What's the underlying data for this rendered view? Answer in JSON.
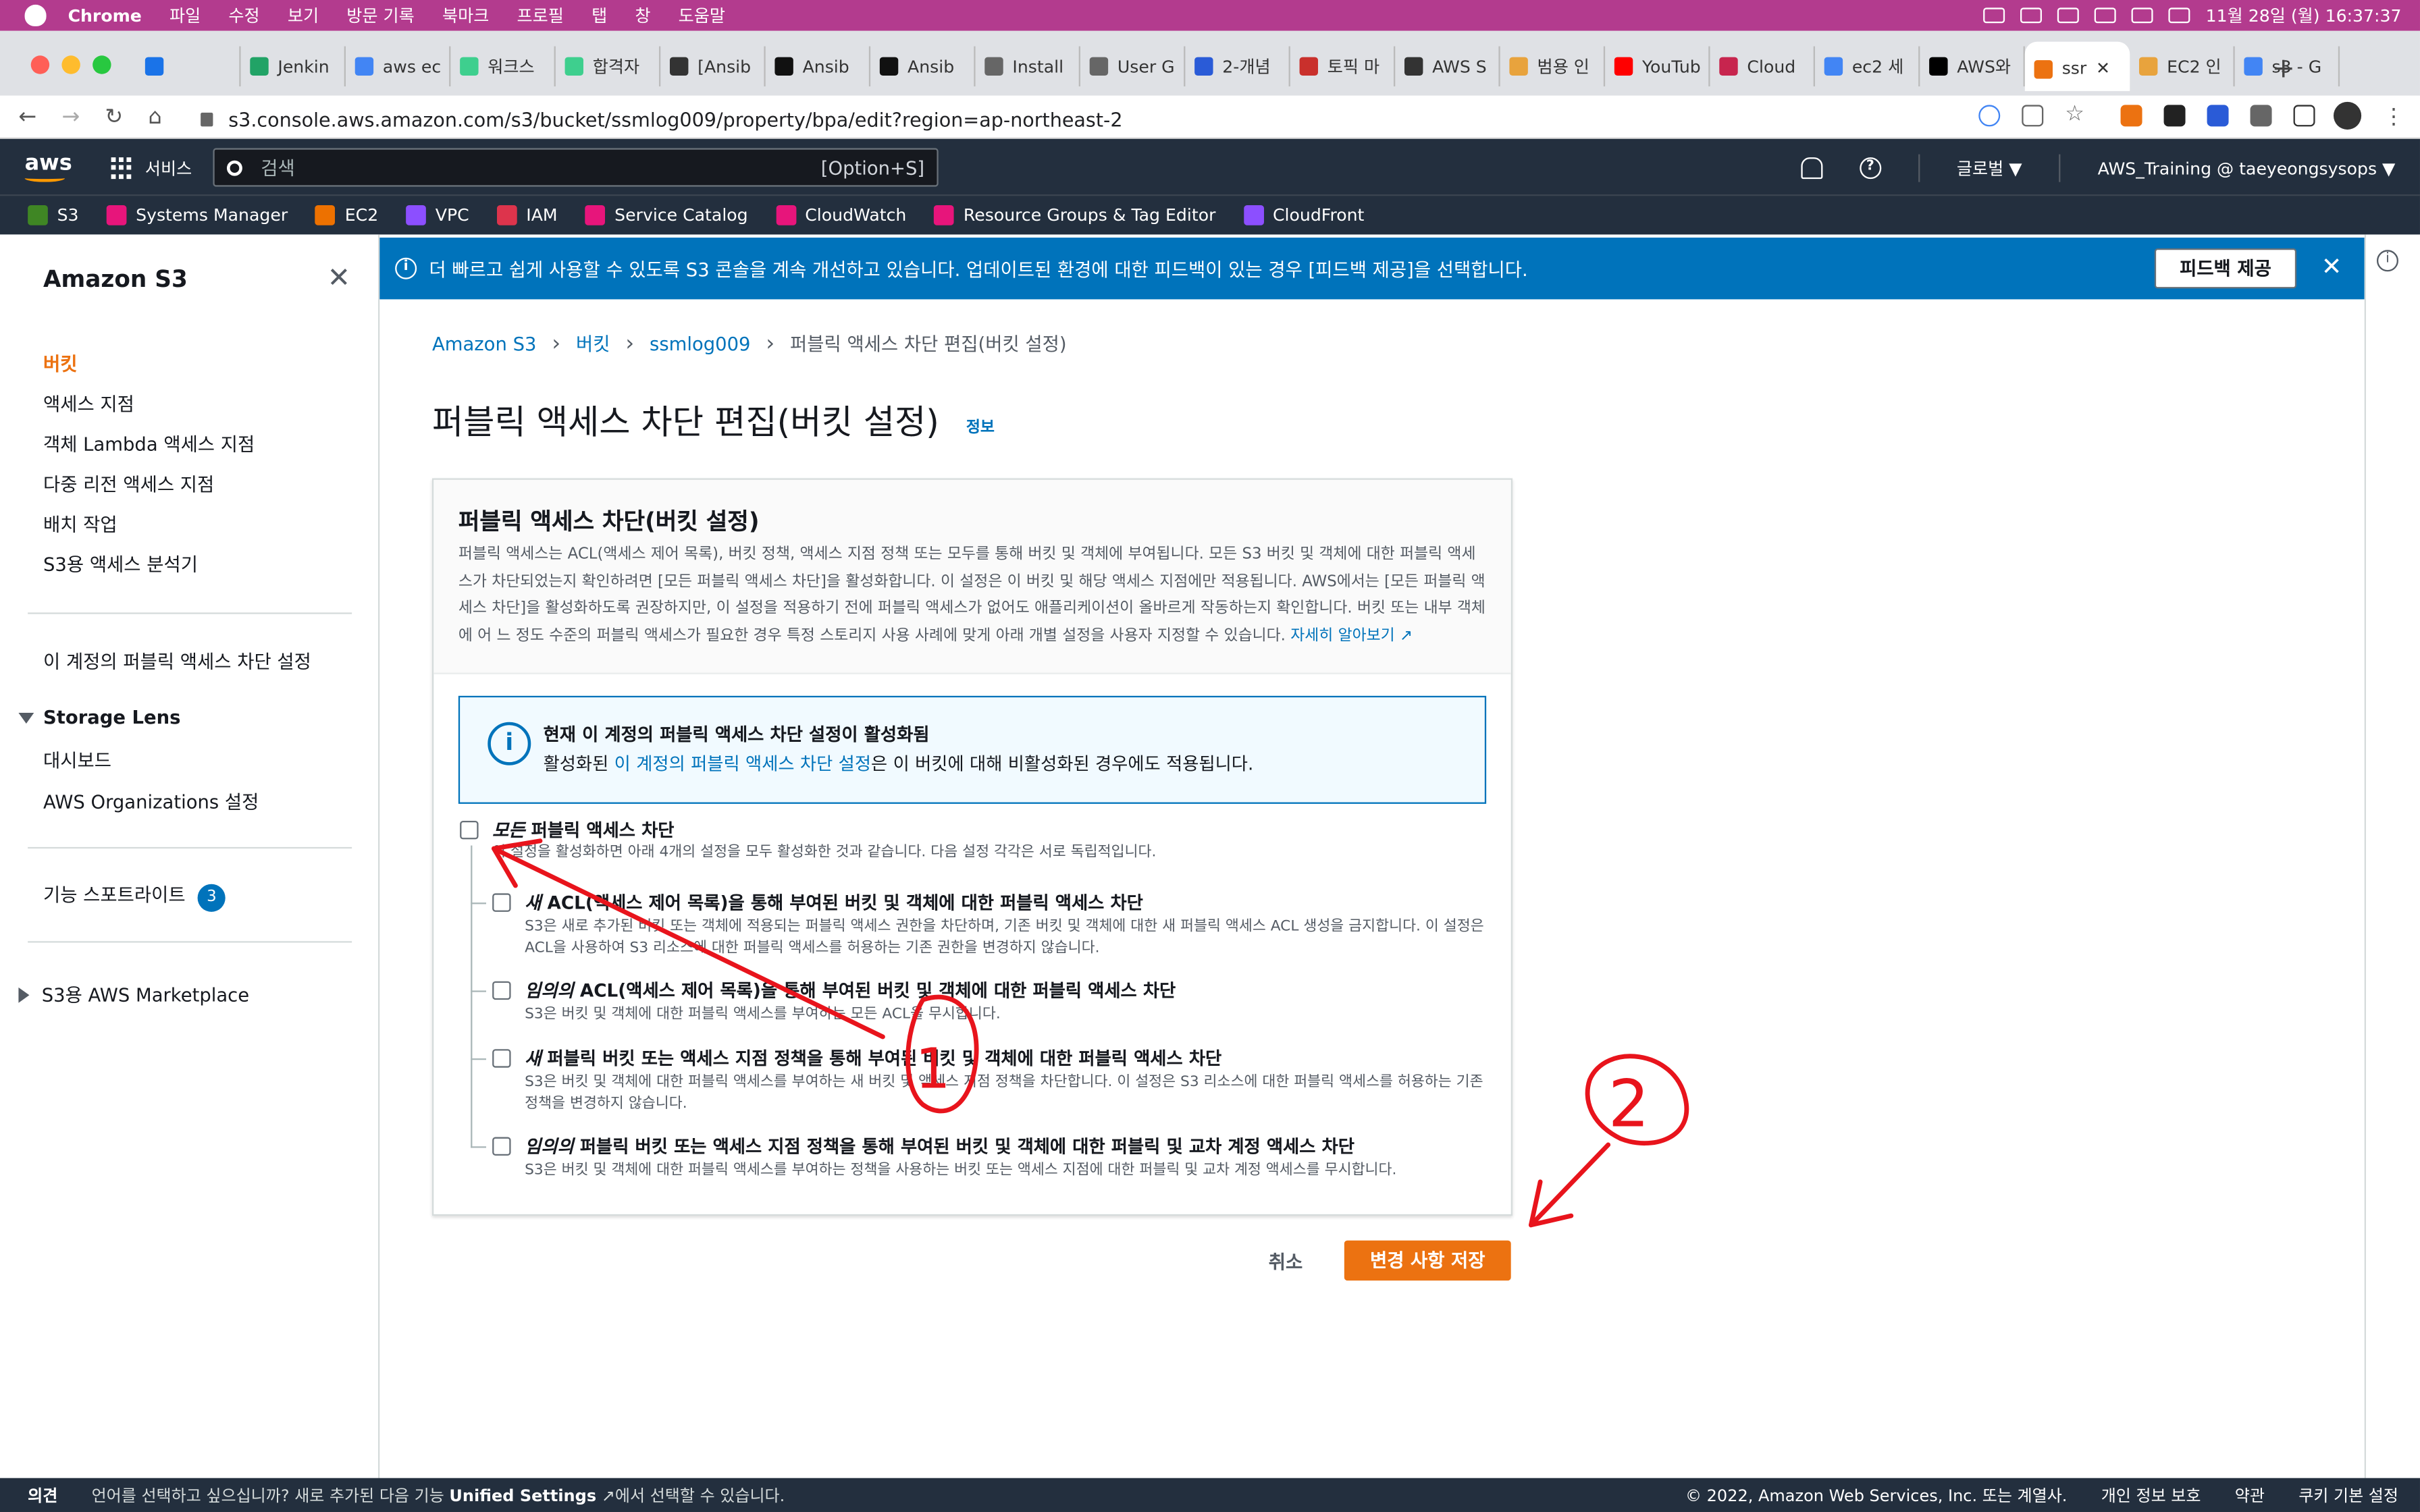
{
  "mac_menu": {
    "app": "Chrome",
    "items": [
      "파일",
      "수정",
      "보기",
      "방문 기록",
      "북마크",
      "프로필",
      "탭",
      "창",
      "도움말"
    ],
    "datetime": "11월 28일 (월)  16:37:37"
  },
  "browser": {
    "tabs": [
      {
        "label": "",
        "color": "#1a73e8"
      },
      {
        "label": "Jenkin",
        "color": "#21a366"
      },
      {
        "label": "aws ec",
        "color": "#4285f4"
      },
      {
        "label": "워크스",
        "color": "#3ecf8e"
      },
      {
        "label": "합격자",
        "color": "#3ecf8e"
      },
      {
        "label": "[Ansib",
        "color": "#333333"
      },
      {
        "label": "Ansib",
        "color": "#111111"
      },
      {
        "label": "Ansib",
        "color": "#111111"
      },
      {
        "label": "Install",
        "color": "#666666"
      },
      {
        "label": "User G",
        "color": "#666666"
      },
      {
        "label": "2-개념",
        "color": "#2a5bd7"
      },
      {
        "label": "토픽 마",
        "color": "#c9302c"
      },
      {
        "label": "AWS S",
        "color": "#333333"
      },
      {
        "label": "범용 인",
        "color": "#e8a33d"
      },
      {
        "label": "YouTub",
        "color": "#ff0000"
      },
      {
        "label": "Cloud",
        "color": "#c7254e"
      },
      {
        "label": "ec2 세",
        "color": "#4285f4"
      },
      {
        "label": "AWS와",
        "color": "#000000"
      },
      {
        "label": "ssr",
        "color": "#ec7211",
        "active": true
      },
      {
        "label": "EC2 인",
        "color": "#e8a33d"
      },
      {
        "label": "s3 - G",
        "color": "#4285f4"
      }
    ],
    "url": "s3.console.aws.amazon.com/s3/bucket/ssmlog009/property/bpa/edit?region=ap-northeast-2"
  },
  "aws_header": {
    "logo": "aws",
    "services": "서비스",
    "search_placeholder": "검색",
    "search_shortcut": "[Option+S]",
    "region": "글로벌 ▼",
    "account": "AWS_Training @ taeyeongsysops ▼"
  },
  "favorites": [
    {
      "label": "S3",
      "color": "#3f8624"
    },
    {
      "label": "Systems Manager",
      "color": "#e7157b"
    },
    {
      "label": "EC2",
      "color": "#ed7100"
    },
    {
      "label": "VPC",
      "color": "#8c4fff"
    },
    {
      "label": "IAM",
      "color": "#dd344c"
    },
    {
      "label": "Service Catalog",
      "color": "#e7157b"
    },
    {
      "label": "CloudWatch",
      "color": "#e7157b"
    },
    {
      "label": "Resource Groups & Tag Editor",
      "color": "#e7157b"
    },
    {
      "label": "CloudFront",
      "color": "#8c4fff"
    }
  ],
  "sidebar": {
    "title": "Amazon S3",
    "items": [
      "버킷",
      "액세스 지점",
      "객체 Lambda 액세스 지점",
      "다중 리전 액세스 지점",
      "배치 작업",
      "S3용 액세스 분석기"
    ],
    "account_bpa": "이 계정의 퍼블릭 액세스 차단 설정",
    "storage_lens": "Storage Lens",
    "storage_lens_items": [
      "대시보드",
      "AWS Organizations 설정"
    ],
    "feature_spotlight": "기능 스포트라이트",
    "feature_spotlight_count": "3",
    "marketplace": "S3용 AWS Marketplace"
  },
  "flash": {
    "message": "더 빠르고 쉽게 사용할 수 있도록 S3 콘솔을 계속 개선하고 있습니다. 업데이트된 환경에 대한 피드백이 있는 경우 [피드백 제공]을 선택합니다.",
    "button": "피드백 제공"
  },
  "breadcrumb": {
    "items": [
      "Amazon S3",
      "버킷",
      "ssmlog009"
    ],
    "current": "퍼블릭 액세스 차단 편집(버킷 설정)"
  },
  "page": {
    "title": "퍼블릭 액세스 차단 편집(버킷 설정)",
    "info": "정보"
  },
  "panel": {
    "title": "퍼블릭 액세스 차단(버킷 설정)",
    "desc_lines": [
      "퍼블릭 액세스는 ACL(액세스 제어 목록), 버킷 정책, 액세스 지점 정책 또는 모두를 통해 버킷 및 객체에 부여됩니다. 모든 S3 버킷 및 객체에 대한 퍼블릭 액세스가",
      "차단되었는지 확인하려면 [모든 퍼블릭 액세스 차단]을 활성화합니다. 이 설정은 이 버킷 및 해당 액세스 지점에만 적용됩니다. AWS에서는 [모든 퍼블릭 액세스",
      "차단]을 활성화하도록 권장하지만, 이 설정을 적용하기 전에 퍼블릭 액세스가 없어도 애플리케이션이 올바르게 작동하는지 확인합니다. 버킷 또는 내부 객체에 어",
      "느 정도 수준의 퍼블릭 액세스가 필요한 경우 특정 스토리지 사용 사례에 맞게 아래 개별 설정을 사용자 지정할 수 있습니다."
    ],
    "learn_more": "자세히 알아보기"
  },
  "alert": {
    "title": "현재 이 계정의 퍼블릭 액세스 차단 설정이 활성화됨",
    "desc_prefix": "활성화된 ",
    "desc_link": "이 계정의 퍼블릭 액세스 차단 설정",
    "desc_suffix": "은 이 버킷에 대해 비활성화된 경우에도 적용됩니다."
  },
  "options": {
    "all": {
      "em": "모든",
      "title": " 퍼블릭 액세스 차단",
      "desc": "이 설정을 활성화하면 아래 4개의 설정을 모두 활성화한 것과 같습니다. 다음 설정 각각은 서로 독립적입니다.",
      "checked": false
    },
    "items": [
      {
        "em": "새",
        "title": " ACL(액세스 제어 목록)을 통해 부여된 버킷 및 객체에 대한 퍼블릭 액세스 차단",
        "desc": "S3은 새로 추가된 버킷 또는 객체에 적용되는 퍼블릭 액세스 권한을 차단하며, 기존 버킷 및 객체에 대한 새 퍼블릭 액세스 ACL 생성을 금지합니다. 이 설정은 ACL을 사용하여 S3 리소스에 대한 퍼블릭 액세스를 허용하는 기존 권한을 변경하지 않습니다.",
        "checked": false
      },
      {
        "em": "임의의",
        "title": " ACL(액세스 제어 목록)을 통해 부여된 버킷 및 객체에 대한 퍼블릭 액세스 차단",
        "desc": "S3은 버킷 및 객체에 대한 퍼블릭 액세스를 부여하는 모든 ACL을 무시합니다.",
        "checked": false
      },
      {
        "em": "새",
        "title": " 퍼블릭 버킷 또는 액세스 지점 정책을 통해 부여된 버킷 및 객체에 대한 퍼블릭 액세스 차단",
        "desc": "S3은 버킷 및 객체에 대한 퍼블릭 액세스를 부여하는 새 버킷 및 액세스 지점 정책을 차단합니다. 이 설정은 S3 리소스에 대한 퍼블릭 액세스를 허용하는 기존 정책을 변경하지 않습니다.",
        "checked": false
      },
      {
        "em": "임의의",
        "title": " 퍼블릭 버킷 또는 액세스 지점 정책을 통해 부여된 버킷 및 객체에 대한 퍼블릭 및 교차 계정 액세스 차단",
        "desc": "S3은 버킷 및 객체에 대한 퍼블릭 액세스를 부여하는 정책을 사용하는 버킷 또는 액세스 지점에 대한 퍼블릭 및 교차 계정 액세스를 무시합니다.",
        "checked": false
      }
    ]
  },
  "actions": {
    "cancel": "취소",
    "save": "변경 사항 저장"
  },
  "footer": {
    "feedback": "의견",
    "lang_prefix": "언어를 선택하고 싶으십니까? 새로 추가된 다음 기능 ",
    "lang_bold": "Unified Settings",
    "lang_suffix": "에서 선택할 수 있습니다.",
    "copyright": "© 2022, Amazon Web Services, Inc. 또는 계열사.",
    "privacy": "개인 정보 보호",
    "terms": "약관",
    "cookies": "쿠키 기본 설정"
  },
  "annotations": {
    "label_1": "1",
    "label_2": "2",
    "color": "#e8141c"
  }
}
